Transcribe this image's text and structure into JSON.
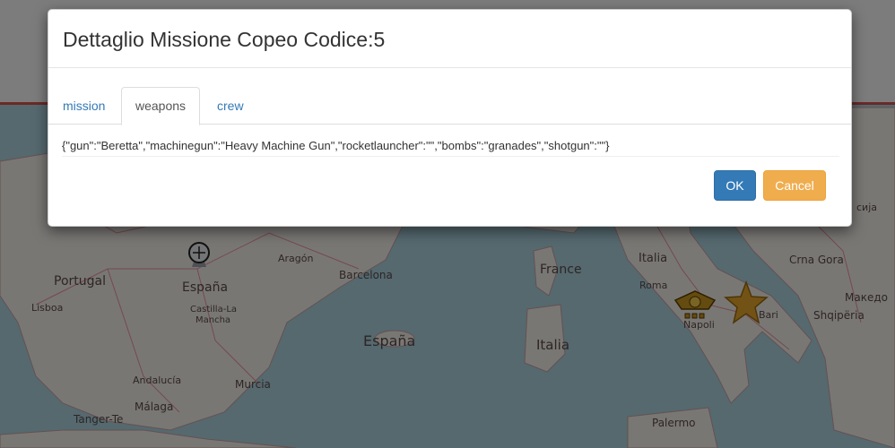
{
  "modal": {
    "title": "Dettaglio Missione Copeo Codice:5",
    "tabs": [
      {
        "label": "mission"
      },
      {
        "label": "weapons"
      },
      {
        "label": "crew"
      }
    ],
    "active_tab": "weapons",
    "content": "{\"gun\":\"Beretta\",\"machinegun\":\"Heavy Machine Gun\",\"rocketlauncher\":\"\",\"bombs\":\"granades\",\"shotgun\":\"\"}",
    "ok_label": "OK",
    "cancel_label": "Cancel"
  },
  "map": {
    "labels": {
      "portugal": "Portugal",
      "lisboa": "Lisboa",
      "espana_main": "España",
      "castilla": "Castilla-La",
      "mancha": "Mancha",
      "aragon": "Aragón",
      "barcelona": "Barcelona",
      "espana_sea": "España",
      "andalucia": "Andalucía",
      "murcia": "Murcia",
      "malaga": "Málaga",
      "tanger": "Tanger-Te",
      "france": "France",
      "italia_main": "Italia",
      "italia_sardinia": "Italia",
      "roma": "Roma",
      "napoli": "Napoli",
      "bari": "Bari",
      "palermo": "Palermo",
      "crna_gora": "Crna Gora",
      "shqiperia": "Shqipëria",
      "makedonija": "Македо",
      "srbija": "сија"
    }
  },
  "colors": {
    "primary": "#337ab7",
    "warning": "#f0ad4e",
    "accent_bar": "#d9534f"
  }
}
